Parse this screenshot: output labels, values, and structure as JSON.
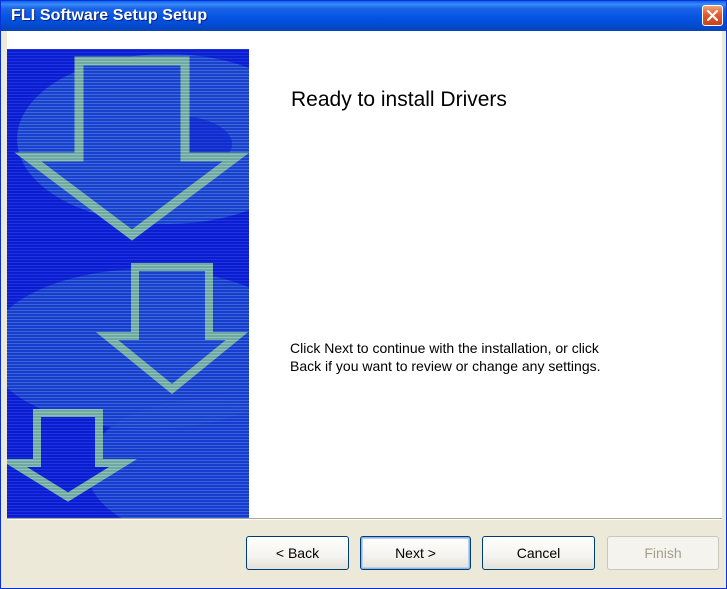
{
  "window": {
    "title": "FLI Software Setup Setup",
    "close_icon": "close-icon"
  },
  "page": {
    "heading": "Ready to install Drivers",
    "description_line1": "Click Next to continue with the installation, or click",
    "description_line2": "Back if you want to review or change any settings."
  },
  "banner": {
    "icons": [
      "arrow-down-icon",
      "arrow-down-icon",
      "arrow-down-icon"
    ],
    "colors": {
      "background": "#0a1dd0",
      "accent": "#6fa8a0"
    }
  },
  "buttons": {
    "back_label": "< Back",
    "next_label": "Next >",
    "cancel_label": "Cancel",
    "finish_label": "Finish"
  }
}
